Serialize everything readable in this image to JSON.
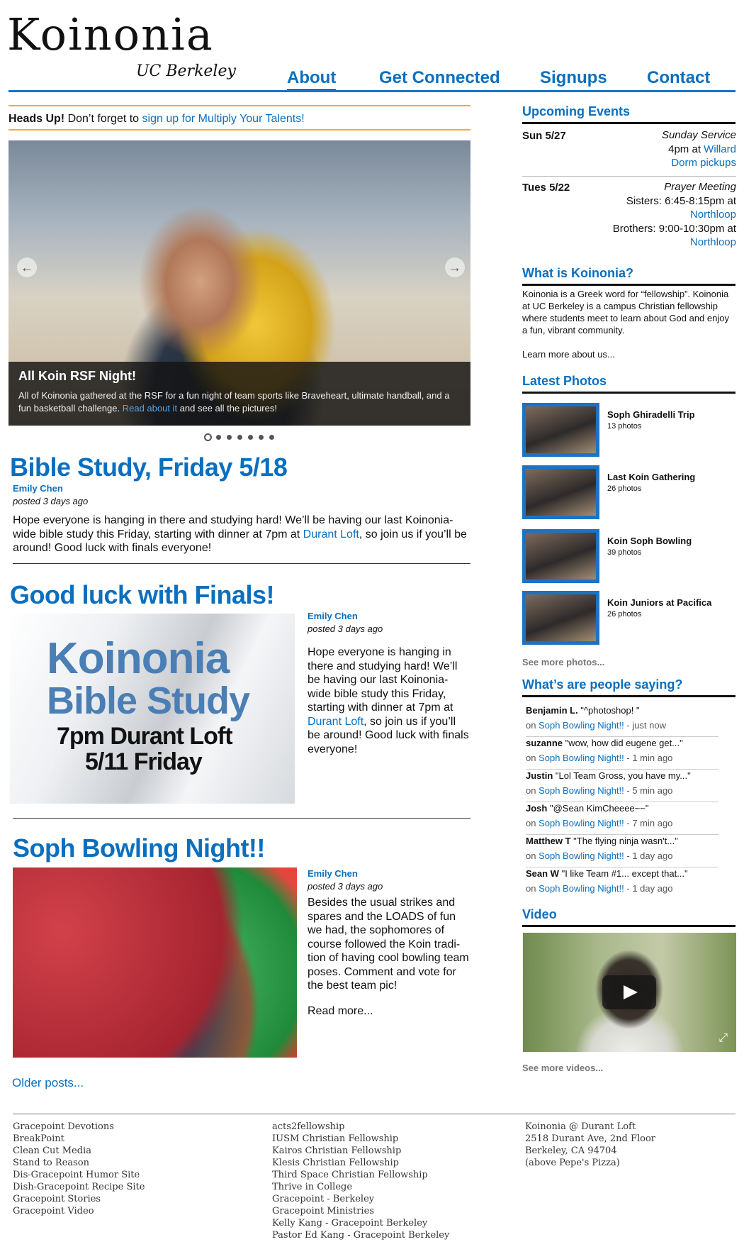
{
  "logo": {
    "word": "Koinonia",
    "sub": "UC Berkeley"
  },
  "nav": [
    {
      "label": "About",
      "active": true
    },
    {
      "label": "Get Connected",
      "active": false
    },
    {
      "label": "Signups",
      "active": false
    },
    {
      "label": "Contact",
      "active": false
    }
  ],
  "headsup": {
    "bold": "Heads Up!",
    "text": " Don’t forget to ",
    "link": "sign up for Multiply Your Talents!"
  },
  "slider": {
    "caption_title": "All Koin RSF Night!",
    "caption_text_1": "All of Koinonia gathered at the RSF for a fun night of team sports like Braveheart, ultimate handball, and a fun basketball challenge. ",
    "caption_link": "Read about it",
    "caption_text_2": " and see all the pictures!",
    "prev_arrow": "←",
    "next_arrow": "→",
    "dot_count": 7
  },
  "posts": [
    {
      "title": "Bible Study, Friday 5/18",
      "author": "Emily Chen",
      "posted": "posted 3 days ago",
      "body_1": "Hope everyone is hanging in there and studying hard! We’ll be having our last Koinonia-wide bible study this Friday, starting with dinner at 7pm at ",
      "body_link": "Durant Loft",
      "body_2": ", so join us if you’ll be around! Good luck with finals everyone!"
    },
    {
      "title": "Good luck with Finals!",
      "author": "Emily Chen",
      "posted": "posted 3 days ago",
      "body_1": "Hope everyone is hanging in there and studying hard! We’ll be having our last Koinonia-wide bible study this Friday, starting with dinner at 7pm at ",
      "body_link": "Durant Loft",
      "body_2": ", so join us if you’ll be around! Good luck with finals everyone!",
      "image_text": {
        "line1": "Koinonia",
        "line2": "Bible Study",
        "line3": "7pm Durant Loft",
        "line4": "5/11 Friday"
      }
    },
    {
      "title": "Soph Bowling Night!!",
      "author": "Emily Chen",
      "posted": "posted 3 days ago",
      "body": "Besides the usual strikes and spares and the LOADS of fun we had, the sophomores of course followed the Koin tradi-tion of having cool bowling team poses. Comment and vote for the best team pic!",
      "read_more": "Read more..."
    }
  ],
  "older_posts": "Older posts...",
  "sidebar": {
    "upcoming_title": "Upcoming Events",
    "events": [
      {
        "date": "Sun 5/27",
        "name": "Sunday Service",
        "line1_text": "4pm at ",
        "line1_link": "Willard",
        "line2_link": "Dorm pickups"
      },
      {
        "date": "Tues 5/22",
        "name": "Prayer Meeting",
        "sisters": "Sisters: 6:45-8:15pm at",
        "sisters_link": "Northloop",
        "brothers": "Brothers: 9:00-10:30pm at",
        "brothers_link": "Northloop"
      }
    ],
    "what_title": "What is Koinonia?",
    "what_text": "Koinonia is a Greek word for “fellowship”. Koinonia at UC Berkeley is a campus Christian fellowship where students meet to learn about God and enjoy a fun, vibrant community.",
    "learn_more": "Learn more about us...",
    "photos_title": "Latest Photos",
    "photos": [
      {
        "title": "Soph Ghiradelli Trip",
        "count": "13 photos"
      },
      {
        "title": "Last Koin Gathering",
        "count": "26 photos"
      },
      {
        "title": "Koin Soph Bowling",
        "count": "39 photos"
      },
      {
        "title": "Koin Juniors at Pacifica",
        "count": "26 photos"
      }
    ],
    "see_more_photos": "See more photos...",
    "saying_title": "What’s are people saying?",
    "comments": [
      {
        "who": "Benjamin L.",
        "what": " \"^photoshop! \"",
        "on": "on ",
        "link": "Soph Bowling Night!!",
        "when": " - just now"
      },
      {
        "who": "suzanne",
        "what": " \"wow, how did eugene get...\"",
        "on": "on ",
        "link": "Soph Bowling Night!!",
        "when": " - 1 min ago"
      },
      {
        "who": "Justin",
        "what": " \"Lol Team Gross, you have my...\"",
        "on": "on ",
        "link": "Soph Bowling Night!!",
        "when": " - 5 min ago"
      },
      {
        "who": "Josh",
        "what": " \"@Sean KimCheeee~~\"",
        "on": "on ",
        "link": "Soph Bowling Night!!",
        "when": " - 7 min ago"
      },
      {
        "who": "Matthew T",
        "what": " \"The flying ninja wasn't...\"",
        "on": "on ",
        "link": "Soph Bowling Night!!",
        "when": " - 1 day ago"
      },
      {
        "who": "Sean W",
        "what": " \"I like Team #1... except that...\"",
        "on": "on ",
        "link": "Soph Bowling Night!!",
        "when": " - 1 day ago"
      }
    ],
    "video_title": "Video",
    "see_more_videos": "See more videos..."
  },
  "footer": {
    "col1": [
      "Gracepoint Devotions",
      "BreakPoint",
      "Clean Cut Media",
      "Stand to Reason",
      "Dis-Gracepoint Humor Site",
      "Dish-Gracepoint Recipe Site",
      "Gracepoint Stories",
      "Gracepoint Video"
    ],
    "col2": [
      "acts2fellowship",
      "IUSM Christian Fellowship",
      "Kairos Christian Fellowship",
      "Klesis Christian Fellowship",
      "Third Space Christian Fellowship",
      "Thrive in College",
      "Gracepoint - Berkeley",
      "Gracepoint Ministries",
      "Kelly Kang - Gracepoint Berkeley",
      "Pastor Ed Kang - Gracepoint Berkeley"
    ],
    "col3": [
      "Koinonia @ Durant Loft",
      "2518 Durant Ave, 2nd Floor",
      "Berkeley, CA 94704",
      "(above Pepe's Pizza)"
    ]
  },
  "colors": {
    "accent": "#0a6fbf",
    "rule_blue": "#1a73c6",
    "headsup_rule": "#f2a93b"
  }
}
